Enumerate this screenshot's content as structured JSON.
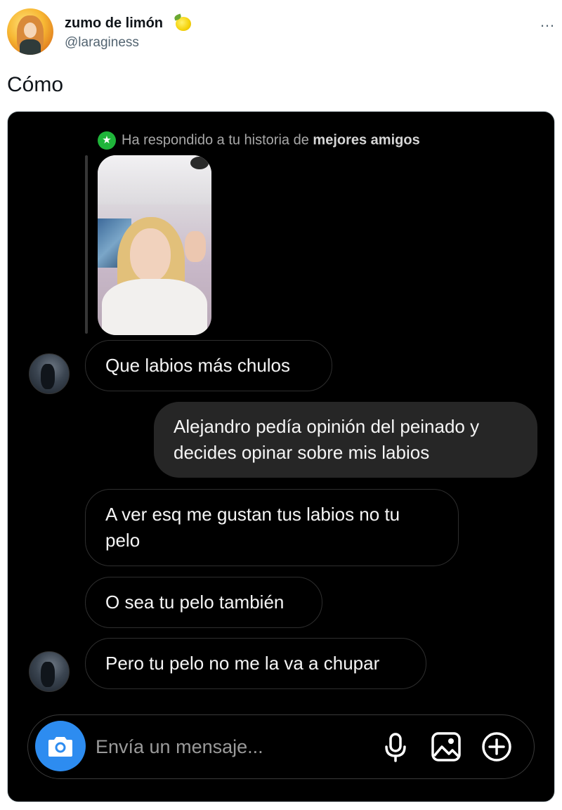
{
  "tweet": {
    "display_name": "zumo de limón",
    "emoji_icon": "lemon-icon",
    "handle": "@laraginess",
    "text": "Cómo",
    "more_icon": "…"
  },
  "dm": {
    "reply_note_prefix": "Ha respondido a tu historia de ",
    "reply_note_bold": "mejores amigos",
    "messages": [
      {
        "from": "them",
        "text": "Que labios más chulos"
      },
      {
        "from": "me",
        "text": "Alejandro pedía opinión del peinado y decides opinar sobre mis labios"
      },
      {
        "from": "them",
        "text": "A ver esq me gustan tus labios no tu pelo"
      },
      {
        "from": "them",
        "text": "O sea tu pelo también"
      },
      {
        "from": "them",
        "text": "Pero tu pelo no me la va a chupar"
      }
    ],
    "composer": {
      "placeholder": "Envía un mensaje...",
      "icons": [
        "camera-icon",
        "microphone-icon",
        "gallery-icon",
        "plus-circle-icon"
      ]
    },
    "colors": {
      "background": "#000000",
      "incoming_bubble_border": "#2e2e2e",
      "outgoing_bubble": "#262626",
      "camera_button": "#2d8cf0",
      "best_friends_badge": "#1fb53a"
    }
  }
}
